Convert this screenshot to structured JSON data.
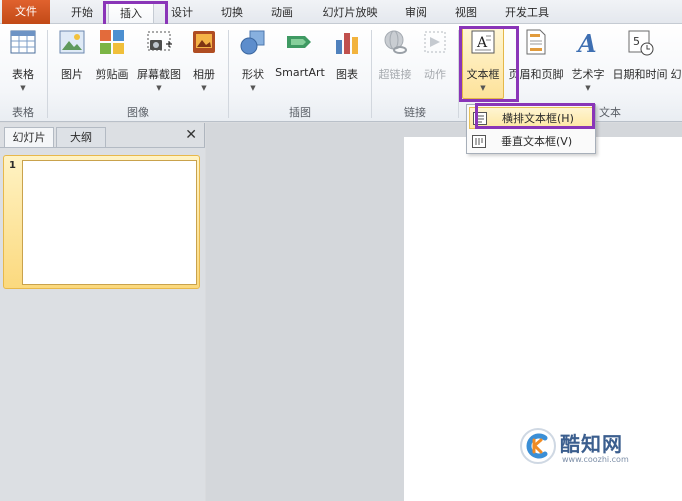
{
  "tabs": [
    "文件",
    "开始",
    "插入",
    "设计",
    "切换",
    "动画",
    "幻灯片放映",
    "审阅",
    "视图",
    "开发工具"
  ],
  "ribbon": {
    "table_label": "表格",
    "picture_label": "图片",
    "clipart_label": "剪贴画",
    "screenshot_label": "屏幕截图",
    "album_label": "相册",
    "shapes_label": "形状",
    "smartart_label": "SmartArt",
    "chart_label": "图表",
    "hyperlink_label": "超链接",
    "action_label": "动作",
    "textbox_label": "文本框",
    "header_footer_label": "页眉和页脚",
    "wordart_label": "艺术字",
    "datetime_label": "日期和时间",
    "overflow_label": "幻",
    "groups": {
      "tables": "表格",
      "images": "图像",
      "illustrations": "插图",
      "links": "链接",
      "text": "文本"
    }
  },
  "dropdown": {
    "horizontal": "横排文本框(H)",
    "vertical": "垂直文本框(V)"
  },
  "left_pane": {
    "slides_tab": "幻灯片",
    "outline_tab": "大纲",
    "close": "✕",
    "slide_number": "1"
  },
  "watermark": {
    "name": "酷知网",
    "url": "www.coozhi.com"
  },
  "colors": {
    "file_tab": "#d35a22",
    "highlight": "#8a35b8",
    "hover_menu": "#fde7a2"
  }
}
